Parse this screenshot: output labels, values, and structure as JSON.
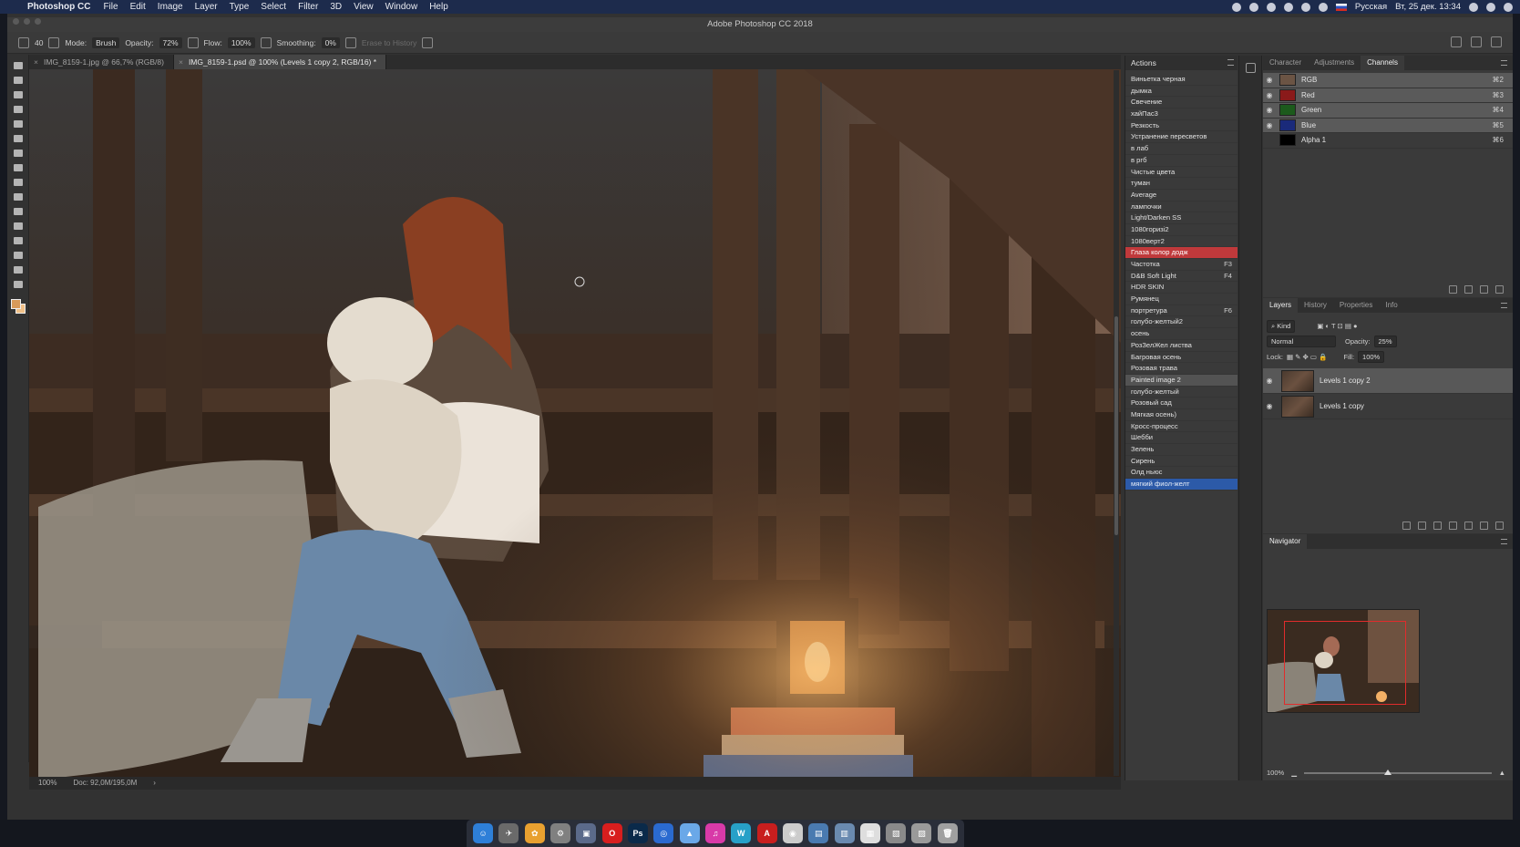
{
  "menubar": {
    "app_name": "Photoshop CC",
    "menus": [
      "File",
      "Edit",
      "Image",
      "Layer",
      "Type",
      "Select",
      "Filter",
      "3D",
      "View",
      "Window",
      "Help"
    ],
    "language": "Русская",
    "datetime": "Вт, 25 дек.  13:34"
  },
  "window": {
    "title": "Adobe Photoshop CC 2018"
  },
  "options": {
    "brush_size": "40",
    "mode_label": "Mode:",
    "mode_value": "Brush",
    "opacity_label": "Opacity:",
    "opacity_value": "72%",
    "flow_label": "Flow:",
    "flow_value": "100%",
    "smoothing_label": "Smoothing:",
    "smoothing_value": "0%",
    "erase_history": "Erase to History"
  },
  "tabs": [
    {
      "label": "IMG_8159-1.jpg @ 66,7% (RGB/8)"
    },
    {
      "label": "IMG_8159-1.psd @ 100% (Levels 1 copy 2, RGB/16) *"
    }
  ],
  "status": {
    "zoom": "100%",
    "doc": "Doc: 92,0M/195,0M"
  },
  "actions": {
    "title": "Actions",
    "items": [
      {
        "label": "Виньетка черная",
        "key": "",
        "state": ""
      },
      {
        "label": "дымка",
        "key": "",
        "state": ""
      },
      {
        "label": "Свечение",
        "key": "",
        "state": ""
      },
      {
        "label": "хайПас3",
        "key": "",
        "state": ""
      },
      {
        "label": "Резкость",
        "key": "",
        "state": ""
      },
      {
        "label": "Устранение пересветов",
        "key": "",
        "state": ""
      },
      {
        "label": "в лаб",
        "key": "",
        "state": ""
      },
      {
        "label": "в ргб",
        "key": "",
        "state": ""
      },
      {
        "label": "Чистые цвета",
        "key": "",
        "state": ""
      },
      {
        "label": "туман",
        "key": "",
        "state": ""
      },
      {
        "label": "Average",
        "key": "",
        "state": ""
      },
      {
        "label": "лампочки",
        "key": "",
        "state": ""
      },
      {
        "label": "Light/Darken SS",
        "key": "",
        "state": ""
      },
      {
        "label": "1080горизi2",
        "key": "",
        "state": ""
      },
      {
        "label": "1080верт2",
        "key": "",
        "state": ""
      },
      {
        "label": "Глаза колор додж",
        "key": "",
        "state": "red"
      },
      {
        "label": "Частотка",
        "key": "F3",
        "state": ""
      },
      {
        "label": "D&B Soft Light",
        "key": "F4",
        "state": ""
      },
      {
        "label": "HDR SKIN",
        "key": "",
        "state": ""
      },
      {
        "label": "Румянец",
        "key": "",
        "state": ""
      },
      {
        "label": "портретура",
        "key": "F6",
        "state": ""
      },
      {
        "label": "голубо-желтый2",
        "key": "",
        "state": ""
      },
      {
        "label": "осень",
        "key": "",
        "state": ""
      },
      {
        "label": "РозЗелЖел листва",
        "key": "",
        "state": ""
      },
      {
        "label": "Багровая осень",
        "key": "",
        "state": ""
      },
      {
        "label": "Розовая трава",
        "key": "",
        "state": ""
      },
      {
        "label": "Painted image 2",
        "key": "",
        "state": "gray"
      },
      {
        "label": "голубо-желтый",
        "key": "",
        "state": ""
      },
      {
        "label": "Розовый сад",
        "key": "",
        "state": ""
      },
      {
        "label": "Мягкая осень)",
        "key": "",
        "state": ""
      },
      {
        "label": "Кросс-процесс",
        "key": "",
        "state": ""
      },
      {
        "label": "Шебби",
        "key": "",
        "state": ""
      },
      {
        "label": "Зелень",
        "key": "",
        "state": ""
      },
      {
        "label": "Сирень",
        "key": "",
        "state": ""
      },
      {
        "label": "Олд ньюс",
        "key": "",
        "state": ""
      },
      {
        "label": "мягкий фиол-желт",
        "key": "",
        "state": "blue"
      }
    ]
  },
  "top_panel": {
    "tabs": [
      "Character",
      "Adjustments",
      "Channels"
    ],
    "active": "Channels",
    "channels": [
      {
        "name": "RGB",
        "key": "⌘2",
        "color": "#6b5444"
      },
      {
        "name": "Red",
        "key": "⌘3",
        "color": "#8a1a1a"
      },
      {
        "name": "Green",
        "key": "⌘4",
        "color": "#1c5a1c"
      },
      {
        "name": "Blue",
        "key": "⌘5",
        "color": "#1a2a7a"
      },
      {
        "name": "Alpha 1",
        "key": "⌘6",
        "color": "#000000"
      }
    ]
  },
  "layers_panel": {
    "tabs": [
      "Layers",
      "History",
      "Properties",
      "Info"
    ],
    "active": "Layers",
    "filter": "Kind",
    "blend_mode": "Normal",
    "opacity_label": "Opacity:",
    "opacity_value": "25%",
    "lock_label": "Lock:",
    "fill_label": "Fill:",
    "fill_value": "100%",
    "layers": [
      {
        "name": "Levels 1 copy 2",
        "selected": true
      },
      {
        "name": "Levels 1 copy",
        "selected": false
      }
    ]
  },
  "navigator": {
    "title": "Navigator",
    "zoom": "100%",
    "zoom_fraction": 0.45
  },
  "dock": {
    "apps": [
      {
        "name": "finder-icon",
        "color": "#2e7fd8",
        "glyph": "☺"
      },
      {
        "name": "launchpad-icon",
        "color": "#6a6a6a",
        "glyph": "✈"
      },
      {
        "name": "photos-icon",
        "color": "#e8a030",
        "glyph": "✿"
      },
      {
        "name": "system-preferences-icon",
        "color": "#808080",
        "glyph": "⚙"
      },
      {
        "name": "preview-icon",
        "color": "#5b6a8a",
        "glyph": "▣"
      },
      {
        "name": "opera-icon",
        "color": "#d81e1e",
        "glyph": "O"
      },
      {
        "name": "photoshop-icon",
        "color": "#0a2a4a",
        "glyph": "Ps"
      },
      {
        "name": "safari-icon",
        "color": "#2a6ad0",
        "glyph": "◎"
      },
      {
        "name": "vpn-icon",
        "color": "#6aa8e8",
        "glyph": "▲"
      },
      {
        "name": "itunes-icon",
        "color": "#d83aa8",
        "glyph": "♫"
      },
      {
        "name": "word-app-icon",
        "color": "#27a0c8",
        "glyph": "W"
      },
      {
        "name": "acrobat-icon",
        "color": "#c81e1e",
        "glyph": "A"
      },
      {
        "name": "camera-app-icon",
        "color": "#cccccc",
        "glyph": "◉"
      },
      {
        "name": "folder-icon",
        "color": "#4a7ab0",
        "glyph": "▤"
      },
      {
        "name": "downloads-icon",
        "color": "#6a8ab0",
        "glyph": "▥"
      },
      {
        "name": "document-icon",
        "color": "#dedede",
        "glyph": "▦"
      },
      {
        "name": "screenshot-icon",
        "color": "#8a8a8a",
        "glyph": "▧"
      },
      {
        "name": "stack-icon",
        "color": "#9a9a9a",
        "glyph": "▨"
      },
      {
        "name": "trash-icon",
        "color": "#a0a0a0",
        "glyph": "🗑"
      }
    ]
  }
}
